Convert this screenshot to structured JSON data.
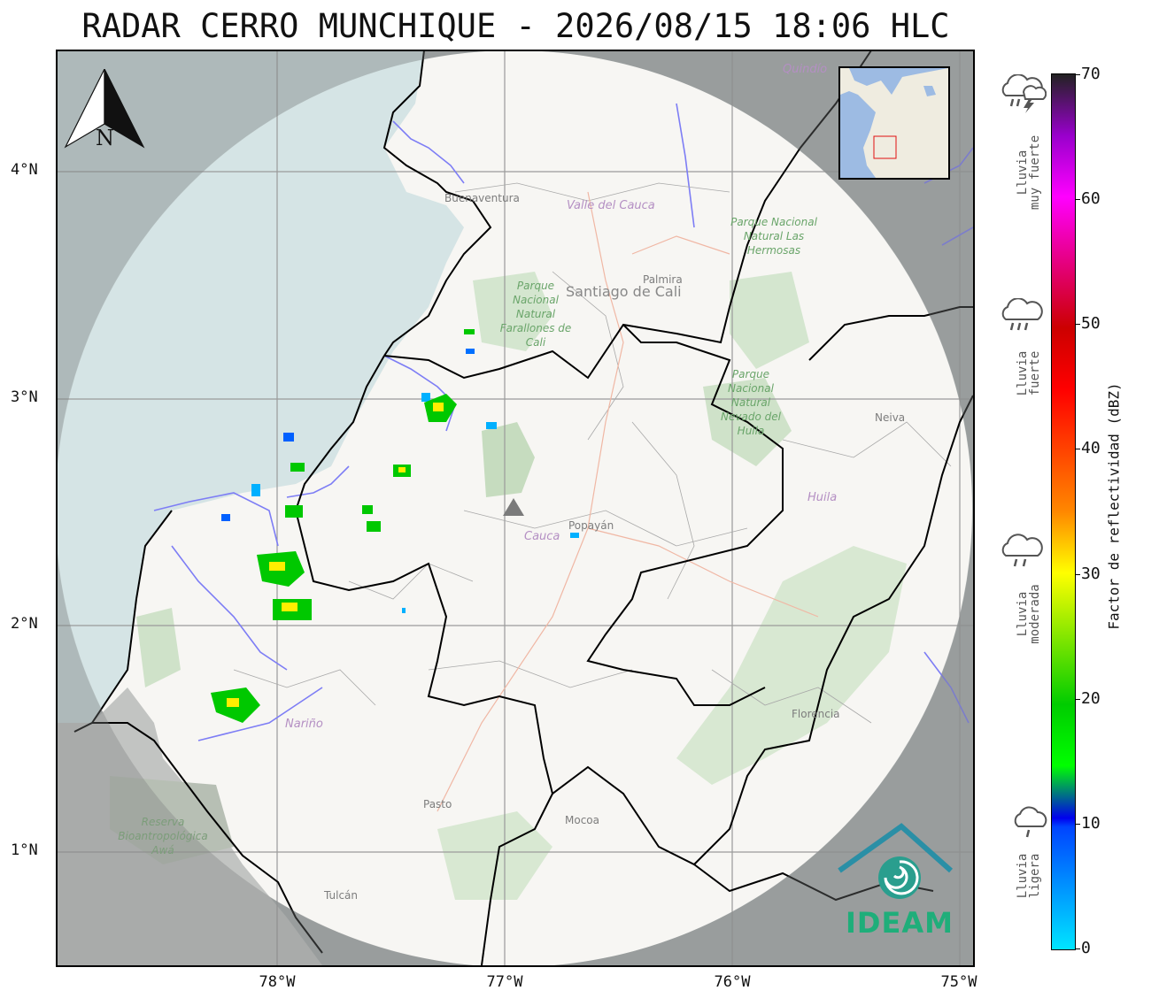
{
  "title": "RADAR CERRO MUNCHIQUE - 2026/08/15 18:06 HLC",
  "map": {
    "lat_ticks": [
      "4°N",
      "3°N",
      "2°N",
      "1°N"
    ],
    "lon_ticks": [
      "78°W",
      "77°W",
      "76°W",
      "75°W"
    ],
    "places": {
      "buenaventura": "Buenaventura",
      "palmira": "Palmira",
      "neiva": "Neiva",
      "popayan": "Popayán",
      "florencia": "Florencia",
      "pasto": "Pasto",
      "mocoa": "Mocoa",
      "tulcan": "Tulcán",
      "santiago_de_cali": "Santiago de Cali"
    },
    "departments": {
      "valle": "Valle del Cauca",
      "cauca": "Cauca",
      "huila": "Huila",
      "narino": "Nariño",
      "quindio": "Quindío"
    },
    "parks": {
      "farallones": "Parque Nacional Natural Farallones de Cali",
      "hermosas": "Parque Nacional Natural Las Hermosas",
      "huila_park": "Parque Nacional Natural Nevado del Huila",
      "awa": "Reserva Bioantropológica Awá"
    },
    "north_arrow": "N",
    "radar_site_icon": "triangle-icon"
  },
  "logo": {
    "name": "IDEAM",
    "color": "#1fae7a"
  },
  "colorbar": {
    "title": "Factor de reflectividad (dBZ)",
    "ticks": [
      "0",
      "10",
      "20",
      "30",
      "40",
      "50",
      "60",
      "70"
    ],
    "range": [
      0,
      70
    ],
    "categories": [
      {
        "label_1": "Lluvia",
        "label_2": "ligera",
        "icon": "cloud-light-rain-icon"
      },
      {
        "label_1": "Lluvia",
        "label_2": "moderada",
        "icon": "cloud-moderate-rain-icon"
      },
      {
        "label_1": "Lluvia",
        "label_2": "fuerte",
        "icon": "cloud-heavy-rain-icon"
      },
      {
        "label_1": "Lluvia",
        "label_2": "muy fuerte",
        "icon": "cloud-storm-icon"
      }
    ]
  }
}
